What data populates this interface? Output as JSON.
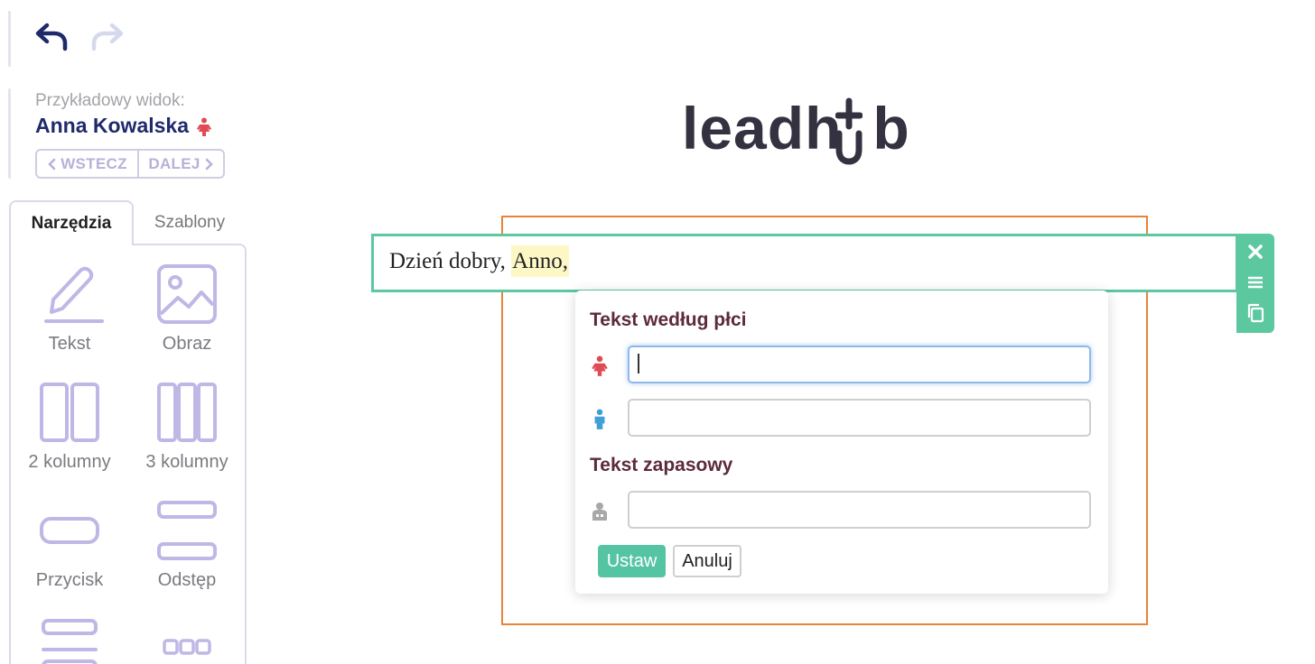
{
  "toolbar": {
    "undo_icon": "undo-arrow-icon",
    "redo_icon": "redo-arrow-icon"
  },
  "preview": {
    "label": "Przykładowy widok:",
    "name": "Anna Kowalska",
    "gender_icon": "female-icon",
    "prev_label": "WSTECZ",
    "next_label": "DALEJ"
  },
  "tabs": {
    "tools": "Narzędzia",
    "templates": "Szablony"
  },
  "tools": [
    {
      "label": "Tekst",
      "icon": "pencil-icon"
    },
    {
      "label": "Obraz",
      "icon": "image-icon"
    },
    {
      "label": "2 kolumny",
      "icon": "two-columns-icon"
    },
    {
      "label": "3 kolumny",
      "icon": "three-columns-icon"
    },
    {
      "label": "Przycisk",
      "icon": "button-icon"
    },
    {
      "label": "Odstęp",
      "icon": "spacer-icon"
    }
  ],
  "logo": {
    "text_left": "leadh",
    "text_right": "b"
  },
  "editor": {
    "greeting_prefix": "Dzień dobry,",
    "greeting_highlight": "Anno,",
    "block_actions": [
      "close-icon",
      "menu-icon",
      "duplicate-icon"
    ]
  },
  "popup": {
    "gender_heading": "Tekst według płci",
    "female_value": "",
    "male_value": "",
    "fallback_heading": "Tekst zapasowy",
    "fallback_value": "",
    "set_label": "Ustaw",
    "cancel_label": "Anuluj"
  },
  "colors": {
    "accent_green": "#5cc8a0",
    "frame_orange": "#e8833a",
    "heading_maroon": "#5c2a3c",
    "female_red": "#e04a52",
    "male_blue": "#3f9fd6",
    "name_navy": "#1f2a6b"
  }
}
